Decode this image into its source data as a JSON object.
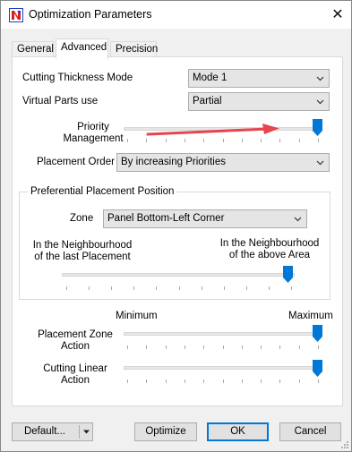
{
  "window": {
    "title": "Optimization Parameters",
    "close_glyph": "✕",
    "icon": "app-logo-icon"
  },
  "tabs": [
    {
      "label": "General",
      "active": false
    },
    {
      "label": "Advanced",
      "active": true
    },
    {
      "label": "Precision",
      "active": false
    }
  ],
  "advanced": {
    "cutting_thickness_mode": {
      "label": "Cutting Thickness Mode",
      "value": "Mode 1"
    },
    "virtual_parts_use": {
      "label": "Virtual Parts use",
      "value": "Partial"
    },
    "priority_management": {
      "label_line1": "Priority",
      "label_line2": "Management",
      "level": 1.0
    },
    "placement_order": {
      "label": "Placement Order",
      "value": "By increasing Priorities"
    },
    "preferential_group": {
      "title": "Preferential Placement Position",
      "zone": {
        "label": "Zone",
        "value": "Panel Bottom-Left Corner"
      },
      "left_line1": "In the Neighbourhood",
      "left_line2": "of the last Placement",
      "right_line1": "In the Neighbourhood",
      "right_line2": "of the above Area",
      "level": 1.0
    },
    "scale_min": "Minimum",
    "scale_max": "Maximum",
    "placement_zone_action": {
      "label_line1": "Placement Zone",
      "label_line2": "Action",
      "level": 1.0
    },
    "cutting_linear_action": {
      "label_line1": "Cutting Linear",
      "label_line2": "Action",
      "level": 1.0
    }
  },
  "footer": {
    "default_label": "Default...",
    "optimize_label": "Optimize",
    "ok_label": "OK",
    "cancel_label": "Cancel"
  },
  "colors": {
    "accent": "#0078d7",
    "annotation_arrow": "#e5454b",
    "logo_red": "#d81e1e",
    "logo_blue": "#1d3fbf"
  }
}
